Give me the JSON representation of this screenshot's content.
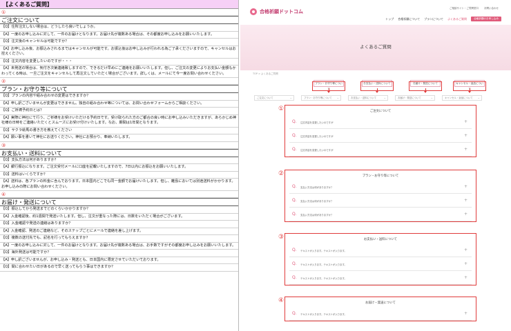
{
  "left": {
    "title": "【よくあるご質問】",
    "blocks": [
      {
        "num": "①",
        "category": "ご注文について",
        "lines": [
          "【Q】住所注文しない場合は、どうしたら良いでしょうか。",
          "【A】一度のお申し込みに対して、一件のお届けとなります。お届け先が複数ある場合は、その都度お申し込みをお願いいたします。",
          "【Q】注文後のキャンセルは可能ですか？",
          "【A】お申し込み後、お振込みされるまではキャンセルが可能です。お振込後はお申し込みが行われる為ご了承くださいますので、キャンセルはお控えください。",
          "【Q】注文内容を変更したいのですが・・・",
          "【A】未発送の場合は、気付き次第連絡致しますので、できるだけ早めにご連絡をお願いいたします。但し、ご注文の変更によりお支払い金額もかわってくる時は、一旦ご注文をキャンセルして再注文していただく場合がございます。詳しくは、メールにて今一度お問い合わせください。"
        ]
      },
      {
        "num": "②",
        "category": "プラン・お守り等について",
        "lines": [
          "【Q】プランの内容や組み合わせの変更はできますか？",
          "【A】申し訳ございませんが変更はできません。独自の組み合わせ等については、お問い合わせフォームからご相談ください。",
          "【Q】ご祈祷予約日とは？",
          "【A】実際に神社にて行う、ご祈祷をお受けいただける予約日です。受け取られた方のご都合の良い時にお申し込みいただきますが、あらかじめ神社様の日時をご連絡いただくとスムーズにお受け付けいたします。なお、期間は1年間となります。",
          "【Q】サクラ絵馬の書き方を教えてください",
          "【A】願い事を書いて神社にお送りください。神社にお預かり、奉納いたします。"
        ]
      },
      {
        "num": "③",
        "category": "お支払い・送料について",
        "lines": [
          "【Q】支払方法は何がありますか？",
          "【A】銀行振込になります。ご注文受付メールに口座を記載いたしますので、7日以内にお振込をお願いいたします。",
          "【Q】送料はいくらですか？",
          "【A】送料は、各プランの料金に含んでおります。日本国内どこでも同一金額でお届けいたします。但し、離島においては別途送料がかかります。お申し込みの際にお問い合わせください。"
        ]
      },
      {
        "num": "④",
        "category": "お届け・発送について",
        "lines": [
          "【Q】振込してから発送までどのくらいかかりますか？",
          "【A】入金確認後、約1週間で発送いたします。但し、注文が重なった際には、日数をいただく場合がございます。",
          "【Q】入金確認や発送の連絡はありますか？",
          "【A】入金確認、発送のご連絡など、そのステップごとにメールで連絡を差し上げます。",
          "【Q】複数の送付先でも、記名を行ってもらえますか？",
          "【A】一度のお申し込みに対して、一件のお届けとなります。お届け先が複数ある場合は、お手数ですがその都度お申し込みをお願いいたします。",
          "【Q】海外発送は可能ですか？",
          "【A】申し訳ございませんが、お申し込み・発送とも、日本国内に限定させていただいております。",
          "【Q】間に合わせたい日があるので早く送ってもらう事はできますか？"
        ]
      }
    ]
  },
  "right": {
    "logo_text": "合格祈願ドットコム",
    "top_links": [
      "ご相談サイト・ご質問窓口",
      "お問い合わせ"
    ],
    "nav": [
      "トップ",
      "合格祈願について",
      "プランについて",
      "よくあるご質問"
    ],
    "nav_button": "合格祈願のお申し込み",
    "hero_title": "よくあるご質問",
    "breadcrumb": "TOP > よくあるご質問",
    "tabs": [
      "プラン・お守り等について",
      "お支払い・送料について",
      "お届け・発送について",
      "キャンセル・返品について"
    ],
    "selects": [
      "ご注文について",
      "プラン・お守り等について",
      "お支払い・送料について",
      "お届け・発送について",
      "キャンセル・返品について"
    ],
    "sections": [
      {
        "num": "①",
        "title": "ご注文について",
        "questions": [
          "注文内容を変更したいのですが",
          "注文内容を変更したいのですが",
          "注文内容を変更したいのですが"
        ]
      },
      {
        "num": "②",
        "title": "プラン・お守り等について",
        "questions": [
          "支払い方法は何がありますか？",
          "支払い方法は何がありますか？",
          "支払い方法は何がありますか？"
        ]
      },
      {
        "num": "③",
        "title": "お支払い・送料について",
        "questions": [
          "テキストが入ります。テキストが入ります。",
          "テキストが入ります。テキストが入ります。",
          "テキストが入ります。テキストが入ります。"
        ]
      },
      {
        "num": "④",
        "title": "お届け・発送について",
        "questions": [
          "テキストが入ります。テキストが入ります。"
        ]
      }
    ]
  },
  "colors": {
    "accent": "#e03a3a",
    "brand": "#e05a7a",
    "title_bg": "#f6d0f6",
    "hero_bg": "#fbeaf0"
  },
  "icons": {
    "logo": "sakura-icon",
    "expand": "plus-icon",
    "dropdown": "chevron-down-icon"
  }
}
